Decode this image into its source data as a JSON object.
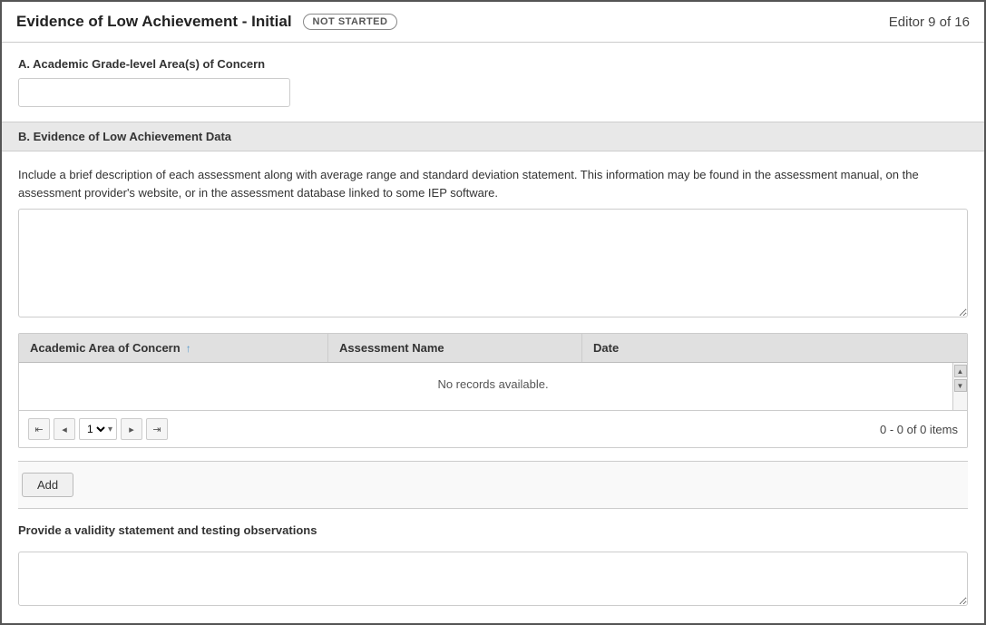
{
  "header": {
    "title": "Evidence of Low Achievement - Initial",
    "status": "NOT STARTED",
    "editor_info": "Editor 9 of 16"
  },
  "section_a": {
    "label": "A. Academic Grade-level Area(s) of Concern",
    "input_placeholder": ""
  },
  "section_b": {
    "label": "B. Evidence of Low Achievement Data",
    "description": "Include a brief description of each assessment along with average range and standard deviation statement. This information may be found in the assessment manual, on the assessment provider's website, or in the assessment database linked to some IEP software.",
    "textarea_placeholder": ""
  },
  "table": {
    "columns": [
      "Academic Area of Concern",
      "Assessment Name",
      "Date"
    ],
    "no_records_text": "No records available.",
    "pagination": {
      "page_info": "0 - 0 of 0 items",
      "page_options": [
        "1"
      ]
    }
  },
  "add_button_label": "Add",
  "validity": {
    "label": "Provide a validity statement and testing observations",
    "textarea_placeholder": ""
  },
  "icons": {
    "sort_up": "↑",
    "first_page": "⊲",
    "prev_page": "◂",
    "next_page": "▸",
    "last_page": "⊳",
    "scroll_up": "▲",
    "scroll_down": "▼",
    "dropdown_arrow": "▾"
  }
}
